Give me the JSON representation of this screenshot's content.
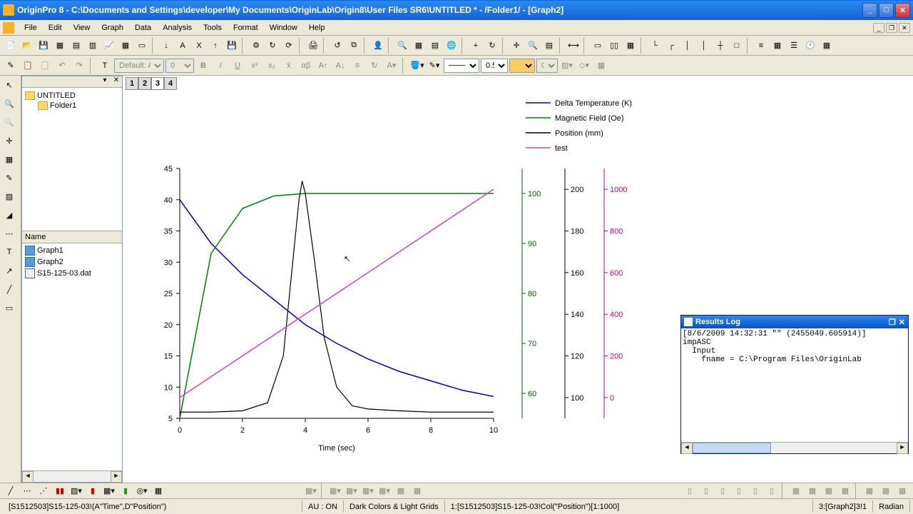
{
  "window": {
    "title": "OriginPro 8 - C:\\Documents and Settings\\developer\\My Documents\\OriginLab\\Origin8\\User Files SR6\\UNTITLED * - /Folder1/ - [Graph2]"
  },
  "menu": {
    "items": [
      "File",
      "Edit",
      "View",
      "Graph",
      "Data",
      "Analysis",
      "Tools",
      "Format",
      "Window",
      "Help"
    ]
  },
  "format_toolbar": {
    "font": "Default: Ar",
    "size": "0",
    "line_width": "0.5",
    "line_width2": "0"
  },
  "explorer": {
    "root": "UNTITLED",
    "folder": "Folder1",
    "list_header": "Name",
    "items": [
      "Graph1",
      "Graph2",
      "S15-125-03.dat"
    ]
  },
  "layer_tabs": [
    "1",
    "2",
    "3",
    "4"
  ],
  "active_layer": "3",
  "chart_data": {
    "type": "line",
    "xlabel": "Time (sec)",
    "x": [
      0,
      1,
      2,
      3,
      4,
      5,
      6,
      7,
      8,
      9,
      10
    ],
    "y1_axis": {
      "label": "",
      "range": [
        5,
        45
      ],
      "ticks": [
        5,
        10,
        15,
        20,
        25,
        30,
        35,
        40,
        45
      ]
    },
    "y2_axis": {
      "range": [
        55,
        105
      ],
      "ticks": [
        60,
        70,
        80,
        90,
        100
      ],
      "color": "#006600"
    },
    "y3_axis": {
      "range": [
        90,
        210
      ],
      "ticks": [
        100,
        120,
        140,
        160,
        180,
        200
      ],
      "color": "#000000"
    },
    "y4_axis": {
      "range": [
        -100,
        1100
      ],
      "ticks": [
        0,
        200,
        400,
        600,
        800,
        1000
      ],
      "color": "#cc0088"
    },
    "series": [
      {
        "name": "Delta Temperature (K)",
        "color": "#0000cc",
        "axis": "y1",
        "values": [
          40,
          33,
          28,
          24,
          20,
          17,
          14.5,
          12.5,
          11,
          9.5,
          8.5
        ]
      },
      {
        "name": "Magnetic Field (Oe)",
        "color": "#008000",
        "axis": "y2",
        "values": [
          55,
          88,
          97,
          99.5,
          100,
          100,
          100,
          100,
          100,
          100,
          100
        ]
      },
      {
        "name": "Position (mm)",
        "color": "#000000",
        "axis": "y1",
        "values": [
          6,
          6,
          6.2,
          7.5,
          42,
          19,
          8,
          6.5,
          6.2,
          6,
          6
        ]
      },
      {
        "name": "test",
        "color": "#d040d0",
        "axis": "y4",
        "values": [
          0,
          100,
          200,
          300,
          400,
          500,
          600,
          700,
          800,
          900,
          1000
        ]
      }
    ]
  },
  "results_log": {
    "title": "Results Log",
    "content": "[8/6/2009 14:32:31 \"\" (2455049.605914)]\nimpASC\n  Input\n    fname = C:\\Program Files\\OriginLab"
  },
  "status": {
    "left": "[S1512503]S15-125-03!(A\"Time\",D\"Position\")",
    "au": "AU : ON",
    "theme": "Dark Colors & Light Grids",
    "range1": "1:[S1512503]S15-125-03!Col(\"Position\")[1:1000]",
    "range2": "3:[Graph2]3!1",
    "mode": "Radian"
  }
}
